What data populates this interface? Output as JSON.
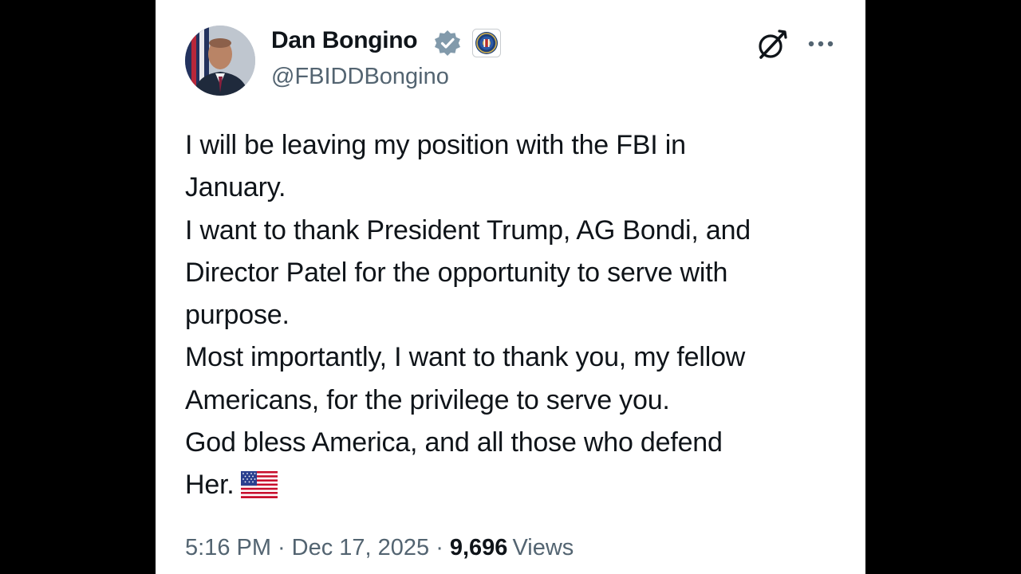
{
  "author": {
    "display_name": "Dan Bongino",
    "handle": "@FBIDDBongino",
    "verified_icon": "verified-badge-icon",
    "affiliation_icon": "fbi-seal-icon"
  },
  "header_actions": {
    "grok_icon": "grok-icon",
    "more_icon": "more-options-icon"
  },
  "tweet": {
    "lines": [
      "I will be leaving my position with the FBI in",
      "January.",
      "I want to thank President Trump, AG Bondi, and",
      "Director Patel for the opportunity to serve with",
      "purpose.",
      "Most importantly, I want to thank you, my fellow",
      "Americans, for the privilege to serve you.",
      "God bless America, and all those who defend",
      "Her."
    ],
    "emoji": "us-flag-emoji"
  },
  "meta": {
    "time": "5:16 PM",
    "separator": "·",
    "date": "Dec 17, 2025",
    "views_count": "9,696",
    "views_label": "Views"
  },
  "colors": {
    "background": "#000000",
    "card": "#ffffff",
    "text_primary": "#0f1419",
    "text_secondary": "#536471",
    "verified_badge": "#829aab"
  }
}
